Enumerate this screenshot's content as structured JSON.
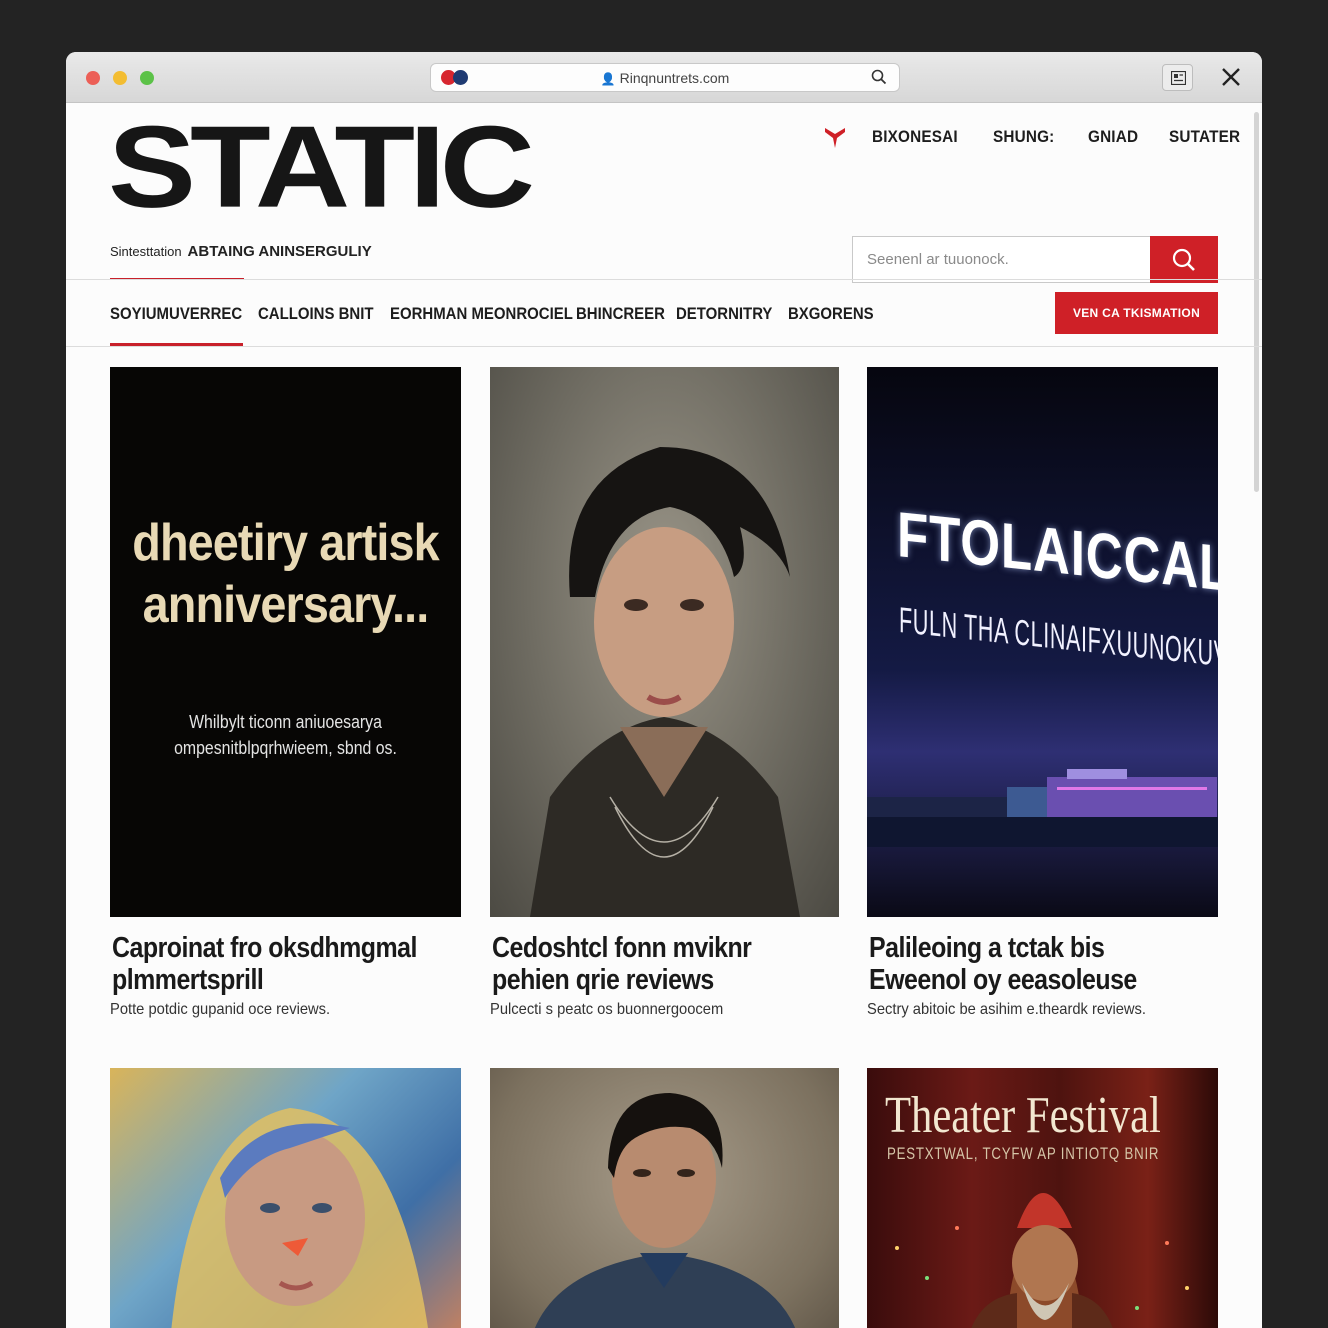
{
  "browser": {
    "url": "Rinqnuntrets.com",
    "icons": [
      "record-icon",
      "nav-icon",
      "person-icon",
      "search-icon",
      "extension-icon",
      "close-icon"
    ]
  },
  "site": {
    "logo": "STATIC",
    "tagline_small": "Sintesttation",
    "tagline_strong": "ABTAING ANINSERGULIY",
    "accent_color": "#cf2027"
  },
  "topnav": {
    "items": [
      "BIXONESAI",
      "SHUNG:",
      "GNIAD",
      "SUTATER"
    ]
  },
  "search": {
    "placeholder": "Seenenl ar tuuonock."
  },
  "categories": {
    "items": [
      "SOYIUMUVERREC",
      "CALLOINS BNIT",
      "EORHMAN MEONROCIEL",
      "BHINCREER",
      "DETORNITRY",
      "BXGORENS"
    ],
    "active": "SOYIUMUVERREC",
    "cta_label": "VEN CA TKISMATION"
  },
  "cards": [
    {
      "poster_main": "dheetiry artisk anniversary...",
      "poster_sub": "Whilbylt ticonn aniuoesaryа ompesnitblpqrhwieem, sbnd os.",
      "title_line1": "Caproinat fro oksdhmgmal",
      "title_line2": "plmmertsprill",
      "subtitle": "Potte potdic gupanid oce reviews."
    },
    {
      "title_line1": "Cedoshtcl fonn mviknr",
      "title_line2": "pehien qrie reviews",
      "subtitle": "Pulcecti s peatc os buonnergoocem"
    },
    {
      "poster_main": "FTOLAICCALTNU",
      "poster_sub": "FULN THA CLINAIFXUUNOKUVII",
      "title_line1": "Palileoing a tctak bis",
      "title_line2": "Eweenol oy eeasoleuse",
      "subtitle": "Sectry abitoic be asihim e.theardk reviews."
    },
    {},
    {},
    {
      "poster_main": "Theater Festival",
      "poster_sub": "PESTXTWAL, TCYFW AP INTIOTQ BNIR"
    }
  ]
}
